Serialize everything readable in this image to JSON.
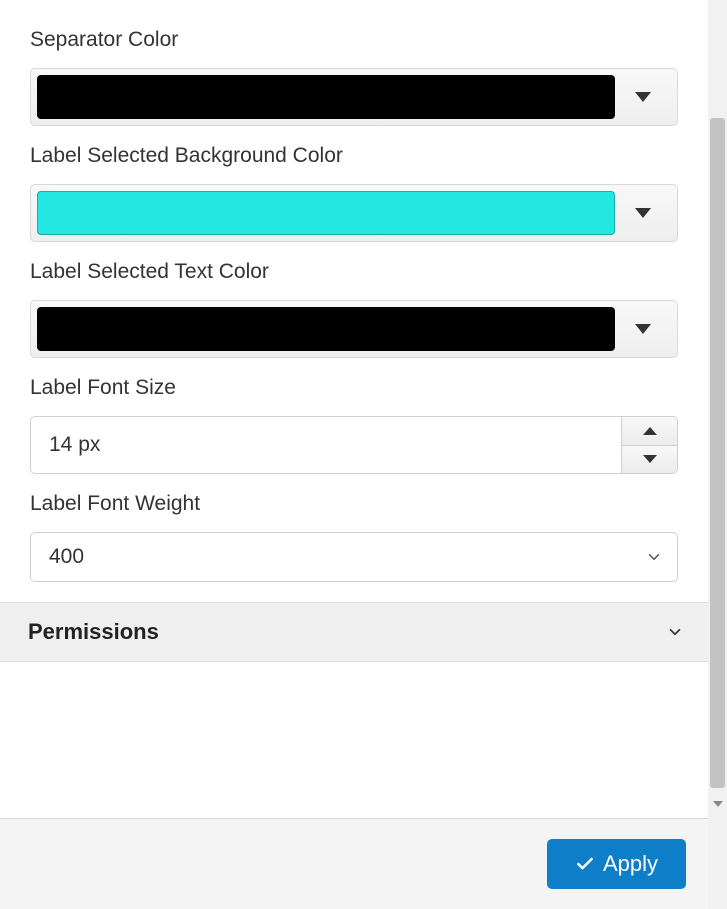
{
  "fields": {
    "separator_color": {
      "label": "Separator Color",
      "value": "#000000"
    },
    "label_selected_bg": {
      "label": "Label Selected Background Color",
      "value": "#22e6e0"
    },
    "label_selected_text": {
      "label": "Label Selected Text Color",
      "value": "#000000"
    },
    "label_font_size": {
      "label": "Label Font Size",
      "value": "14 px"
    },
    "label_font_weight": {
      "label": "Label Font Weight",
      "value": "400"
    }
  },
  "section": {
    "permissions": "Permissions"
  },
  "footer": {
    "apply": "Apply",
    "apply_color": "#0f7ec8"
  }
}
